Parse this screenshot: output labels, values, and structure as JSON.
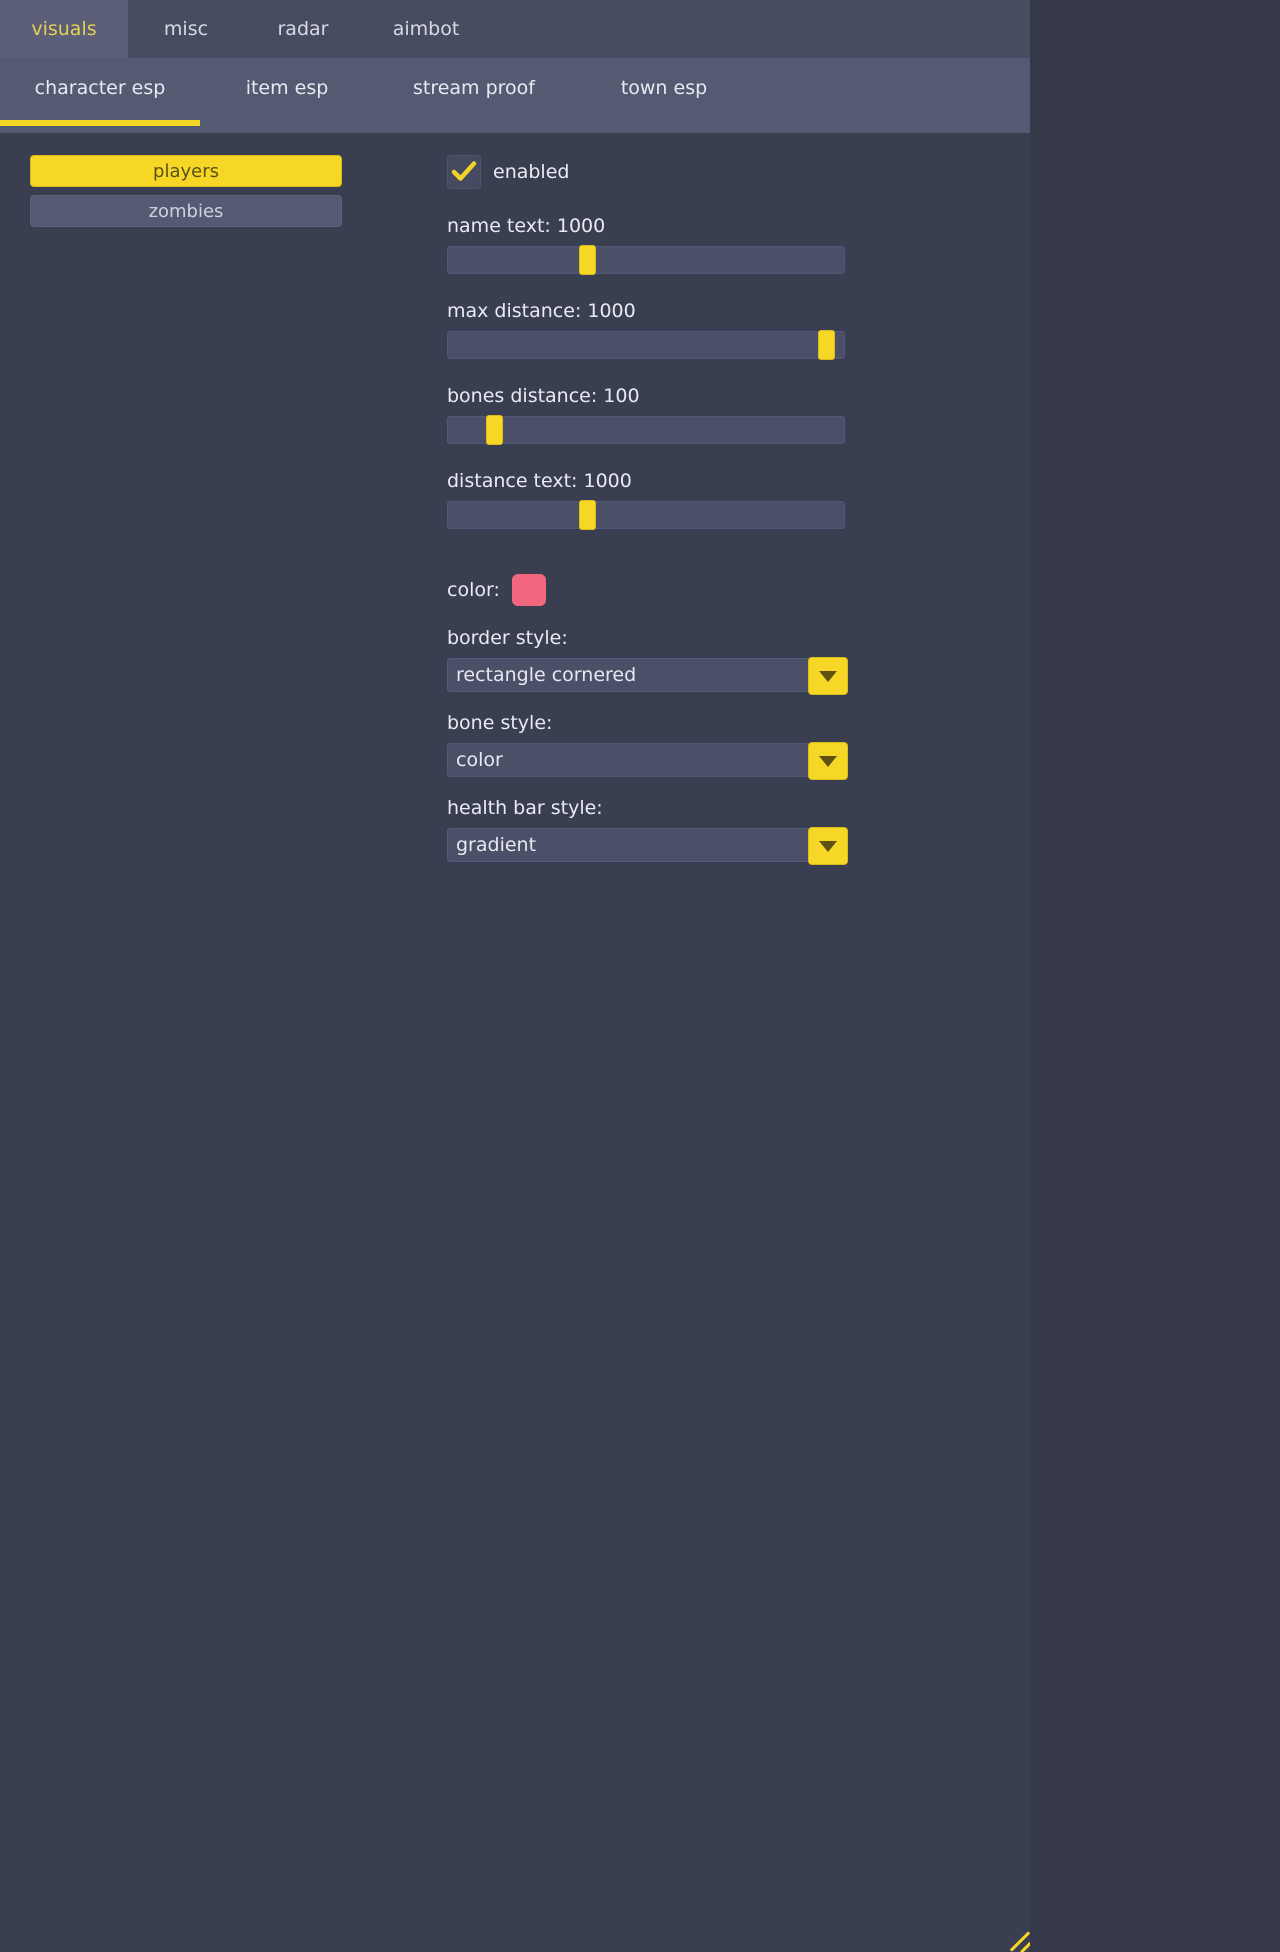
{
  "window": {
    "accent_color": "#f7d726",
    "panel_bg": "#3a3e51",
    "tabbar_bg": "#474c61",
    "subtabbar_bg": "#545a72"
  },
  "tabs_primary": [
    {
      "label": "visuals",
      "active": true
    },
    {
      "label": "misc",
      "active": false
    },
    {
      "label": "radar",
      "active": false
    },
    {
      "label": "aimbot",
      "active": false
    }
  ],
  "tabs_secondary": [
    {
      "label": "character esp",
      "active": true
    },
    {
      "label": "item esp",
      "active": false
    },
    {
      "label": "stream proof",
      "active": false
    },
    {
      "label": "town esp",
      "active": false
    }
  ],
  "sidebar": {
    "items": [
      {
        "label": "players",
        "active": true
      },
      {
        "label": "zombies",
        "active": false
      }
    ]
  },
  "main": {
    "enabled": {
      "label": "enabled",
      "checked": true,
      "icon": "check-icon"
    },
    "sliders": [
      {
        "label": "name text: 1000",
        "name": "name text",
        "value": 1000,
        "fill_percent": 35
      },
      {
        "label": "max distance: 1000",
        "name": "max distance",
        "value": 1000,
        "fill_percent": 95
      },
      {
        "label": "bones distance: 100",
        "name": "bones distance",
        "value": 100,
        "fill_percent": 12
      },
      {
        "label": "distance text: 1000",
        "name": "distance text",
        "value": 1000,
        "fill_percent": 35
      }
    ],
    "color": {
      "label": "color:",
      "value": "#f2677e"
    },
    "dropdowns": [
      {
        "label": "border style:",
        "value": "rectangle cornered",
        "icon": "chevron-down-icon"
      },
      {
        "label": "bone style:",
        "value": "color",
        "icon": "chevron-down-icon"
      },
      {
        "label": "health bar style:",
        "value": "gradient",
        "icon": "chevron-down-icon"
      }
    ]
  }
}
